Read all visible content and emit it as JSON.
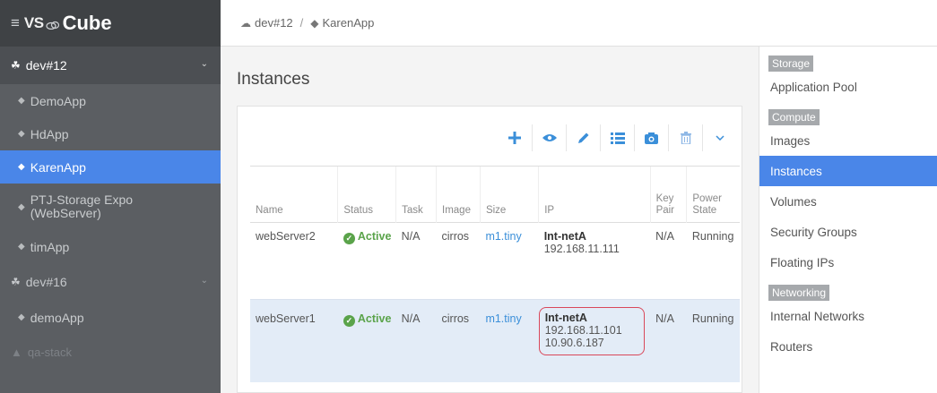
{
  "brand": {
    "menu_icon": "≡",
    "prefix": "VS",
    "name": "Cube"
  },
  "sidebar": {
    "projects": [
      {
        "label": "dev#12",
        "expanded": true
      },
      {
        "label": "dev#16",
        "expanded": false
      },
      {
        "label": "qa-stack"
      }
    ],
    "apps_dev12": [
      {
        "label": "DemoApp"
      },
      {
        "label": "HdApp"
      },
      {
        "label": "KarenApp",
        "selected": true
      },
      {
        "label": "PTJ-Storage Expo\n(WebServer)"
      },
      {
        "label": "timApp"
      }
    ],
    "apps_dev16": [
      {
        "label": "demoApp"
      }
    ]
  },
  "breadcrumb": {
    "project": "dev#12",
    "separator": "/",
    "app": "KarenApp"
  },
  "main": {
    "title": "Instances",
    "toolbar": [
      "add-icon",
      "view-icon",
      "edit-icon",
      "list-icon",
      "snapshot-icon",
      "delete-icon",
      "chevron-down-icon"
    ],
    "columns": [
      "Name",
      "Status",
      "Task",
      "Image",
      "Size",
      "IP",
      "Key\nPair",
      "Power\nState"
    ],
    "rows": [
      {
        "name": "webServer2",
        "status": "Active",
        "task": "N/A",
        "image": "cirros",
        "size": "m1.tiny",
        "network": "Int-netA",
        "ips": [
          "192.168.11.111"
        ],
        "key_pair": "N/A",
        "power_state": "Running"
      },
      {
        "name": "webServer1",
        "status": "Active",
        "task": "N/A",
        "image": "cirros",
        "size": "m1.tiny",
        "network": "Int-netA",
        "ips": [
          "192.168.11.101",
          "10.90.6.187"
        ],
        "key_pair": "N/A",
        "power_state": "Running"
      }
    ]
  },
  "rightpanel": {
    "storage_header": "Storage",
    "storage_items": [
      "Application Pool"
    ],
    "compute_header": "Compute",
    "compute_items": [
      "Images",
      "Instances",
      "Volumes",
      "Security Groups",
      "Floating IPs"
    ],
    "networking_header": "Networking",
    "networking_items": [
      "Internal Networks",
      "Routers"
    ]
  },
  "colors": {
    "sidebar_bg": "#5b5e62",
    "accent_blue": "#4a86e8",
    "active_green": "#5aa34a",
    "highlight_red": "#d9485a"
  }
}
